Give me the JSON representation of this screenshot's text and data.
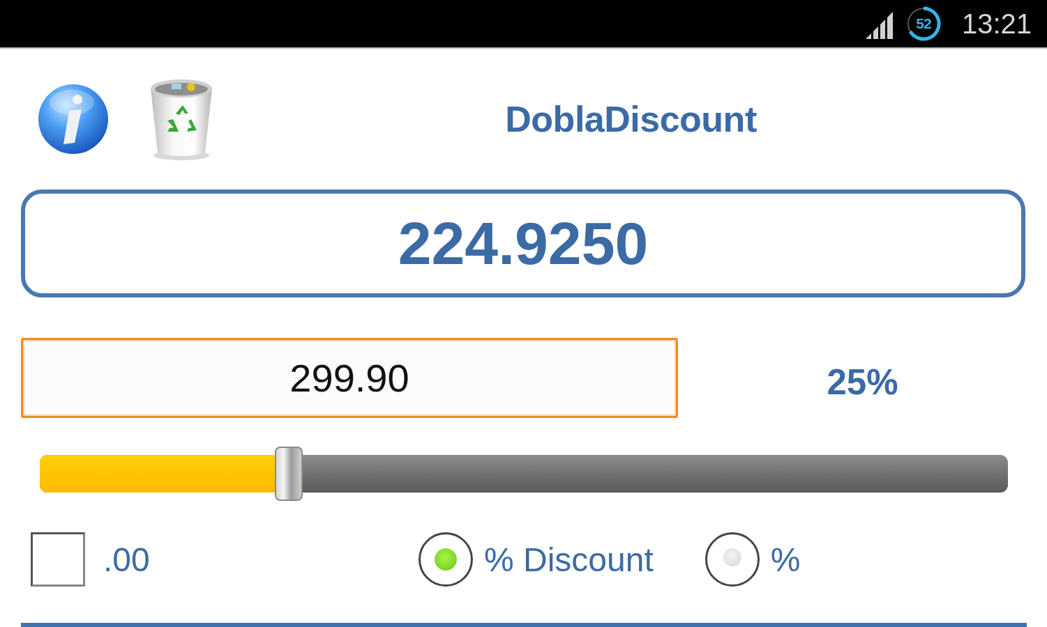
{
  "status_bar": {
    "battery_percent": "52",
    "time": "13:21"
  },
  "header": {
    "title": "DoblaDiscount"
  },
  "result": {
    "value": "224.9250"
  },
  "price_input": {
    "value": "299.90"
  },
  "discount_reading": "25%",
  "discount_slider": {
    "level": 0.25
  },
  "round_option": {
    "label": ".00",
    "checked": false
  },
  "modes": [
    {
      "label": "% Discount",
      "selected": true
    },
    {
      "label": "%",
      "selected": false
    }
  ]
}
